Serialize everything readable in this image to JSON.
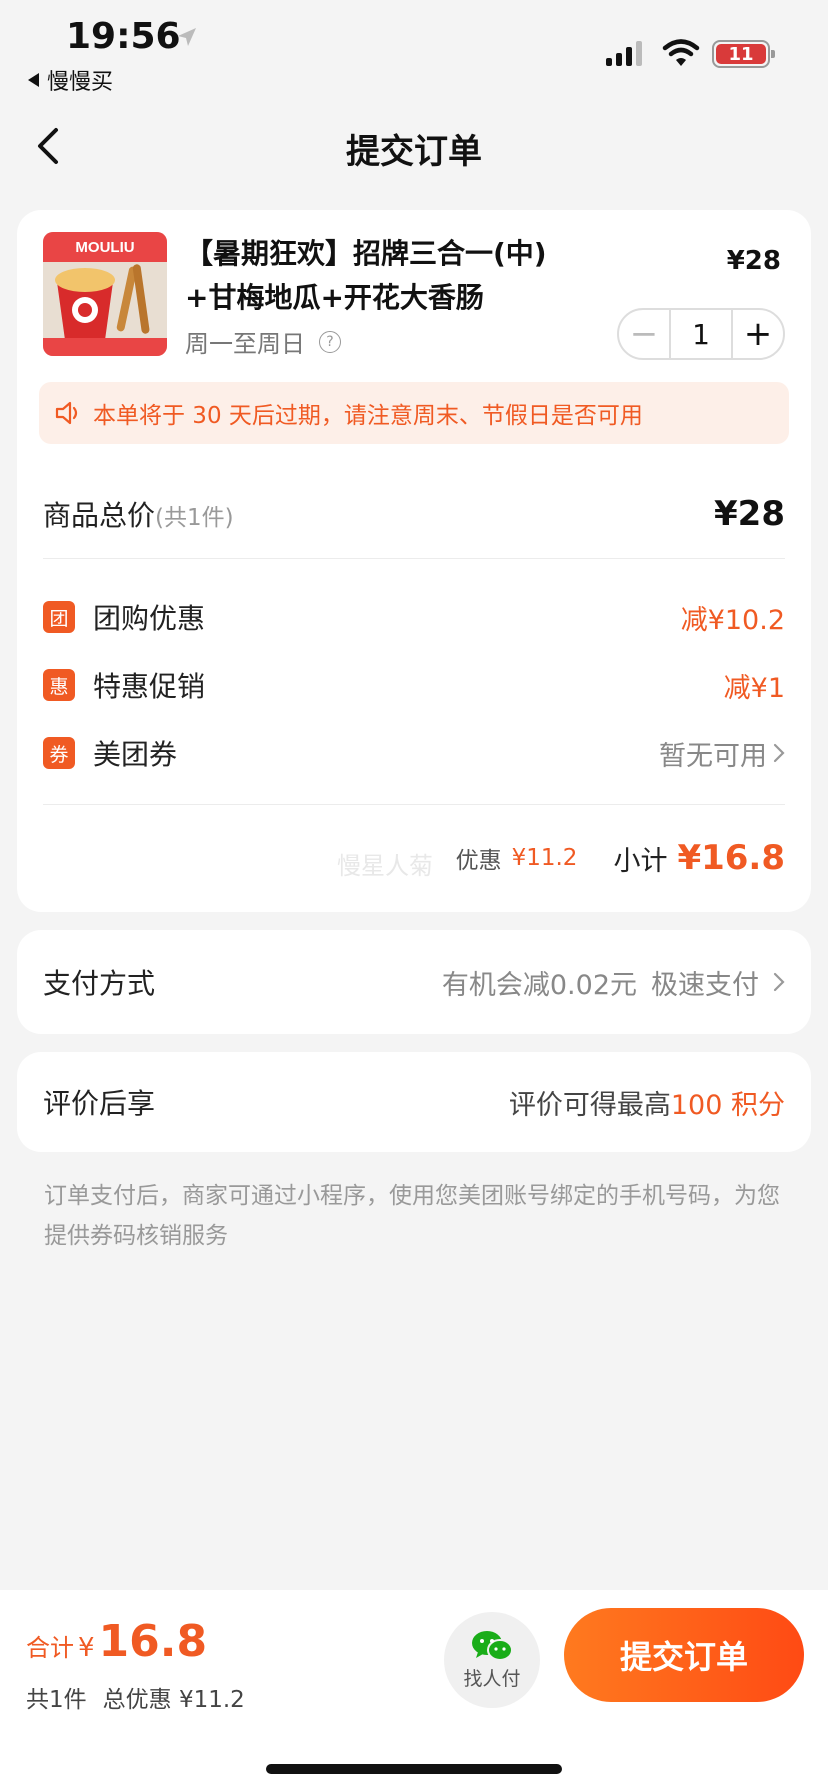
{
  "status": {
    "time": "19:56",
    "back_app": "慢慢买",
    "battery": "11"
  },
  "header": {
    "title": "提交订单"
  },
  "product": {
    "name_line1": "【暑期狂欢】招牌三合一(中)",
    "name_line2": "+甘梅地瓜+开花大香肠",
    "availability": "周一至周日",
    "price": "¥28",
    "quantity": "1",
    "image_brand": "MOULIU"
  },
  "notice": {
    "text": "本单将于 30 天后过期，请注意周末、节假日是否可用"
  },
  "total": {
    "label": "商品总价",
    "count": "(共1件)",
    "value": "¥28"
  },
  "discounts": [
    {
      "badge": "团",
      "label": "团购优惠",
      "value": "减¥10.2"
    },
    {
      "badge": "惠",
      "label": "特惠促销",
      "value": "减¥1"
    },
    {
      "badge": "券",
      "label": "美团券",
      "value": "暂无可用"
    }
  ],
  "watermark": "慢星人菊",
  "subtotal": {
    "discount_label": "优惠",
    "discount_value": "¥11.2",
    "label": "小计",
    "value": "¥16.8"
  },
  "payment": {
    "label": "支付方式",
    "offer": "有机会减0.02元",
    "method": "极速支付"
  },
  "review": {
    "label": "评价后享",
    "text": "评价可得最高",
    "points": "100 积分"
  },
  "footnote": "订单支付后，商家可通过小程序，使用您美团账号绑定的手机号码，为您提供券码核销服务",
  "bottom": {
    "total_label": "合计",
    "currency": "¥",
    "total_amount": "16.8",
    "count": "共1件",
    "total_discount": "总优惠 ¥11.2",
    "friend_pay": "找人付",
    "submit": "提交订单"
  },
  "colors": {
    "accent": "#f05a23",
    "notice_bg": "#fdefe8",
    "page_bg": "#f4f4f4"
  }
}
